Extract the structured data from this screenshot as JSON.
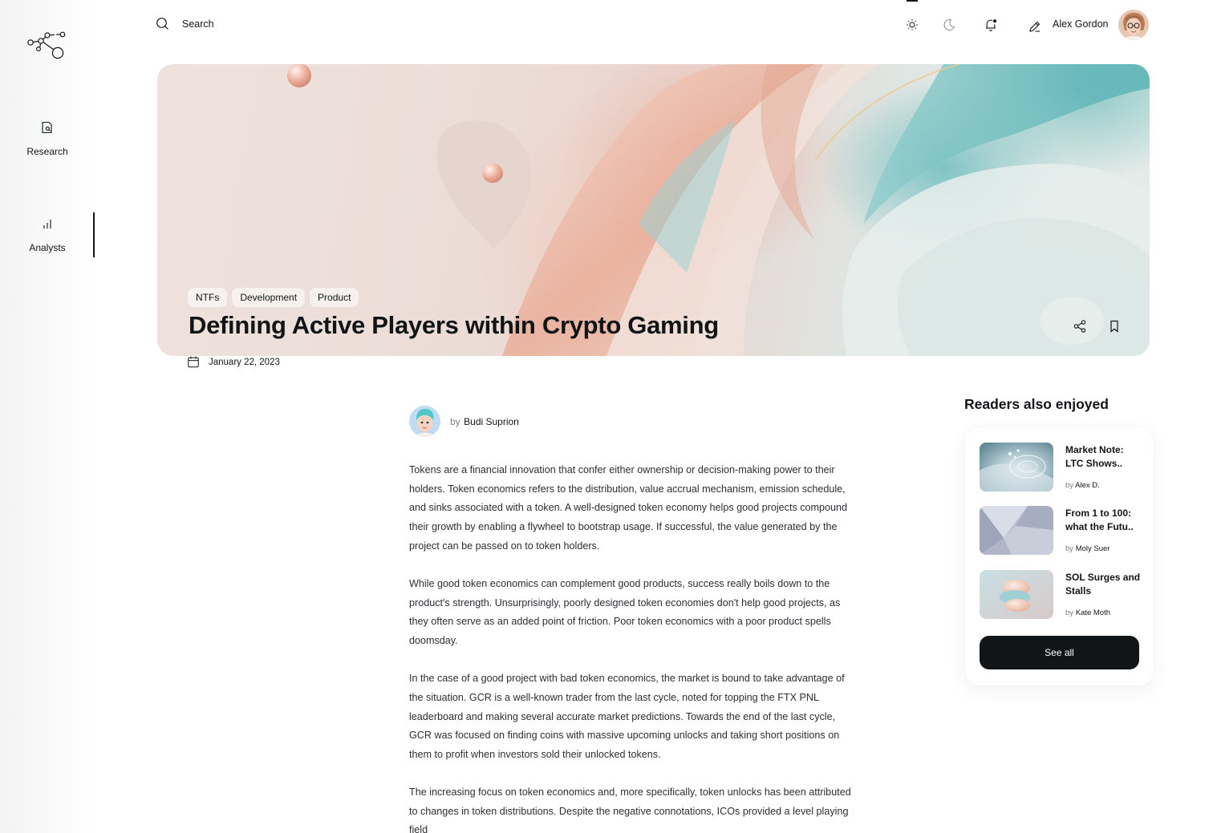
{
  "sidebar": {
    "items": [
      {
        "label": "Research",
        "icon": "research-icon"
      },
      {
        "label": "Analysts",
        "icon": "bar-chart-icon"
      }
    ],
    "active": "Analysts"
  },
  "header": {
    "search_label": "Search",
    "user_name": "Alex Gordon"
  },
  "hero": {
    "tags": [
      "NTFs",
      "Development",
      "Product"
    ],
    "title": "Defining Active Players within Crypto Gaming"
  },
  "article": {
    "date": "January 22, 2023",
    "author_prefix": "by",
    "author_name": "Budi Suprion",
    "paragraphs": [
      "Tokens are a financial innovation that confer either ownership or decision-making power to their holders. Token economics refers to the distribution, value accrual mechanism, emission schedule, and sinks associated with a token. A well-designed token economy helps good projects compound their growth by enabling a flywheel to bootstrap usage. If successful, the value generated by the project can be passed on to token holders.",
      "While good token economics can complement good products, success really boils down to the product's strength. Unsurprisingly, poorly designed token economies don't help good projects, as they often serve as an added point of friction. Poor token economics with a poor product spells doomsday.",
      "In the case of a good project with bad token economics, the market is bound to take advantage of the situation. GCR is a well-known trader from the last cycle, noted for topping the FTX PNL leaderboard and making several accurate market predictions. Towards the end of the last cycle, GCR was focused on finding coins with massive upcoming unlocks and taking short positions on them to profit when investors sold their unlocked tokens.",
      "The increasing focus on token economics and, more specifically, token unlocks has been attributed to changes in token distributions. Despite the negative connotations, ICOs provided a level playing field"
    ]
  },
  "related": {
    "title": "Readers also enjoyed",
    "items": [
      {
        "title": "Market Note: LTC Shows..",
        "by": "by",
        "author": "Alex D."
      },
      {
        "title": "From 1 to 100: what the Futu..",
        "by": "by",
        "author": "Moly Suer"
      },
      {
        "title": "SOL Surges and Stalls",
        "by": "by",
        "author": "Kate Moth"
      }
    ],
    "see_all": "See all"
  },
  "colors": {
    "text": "#121517",
    "muted": "#7a7e82",
    "button": "#121517"
  }
}
